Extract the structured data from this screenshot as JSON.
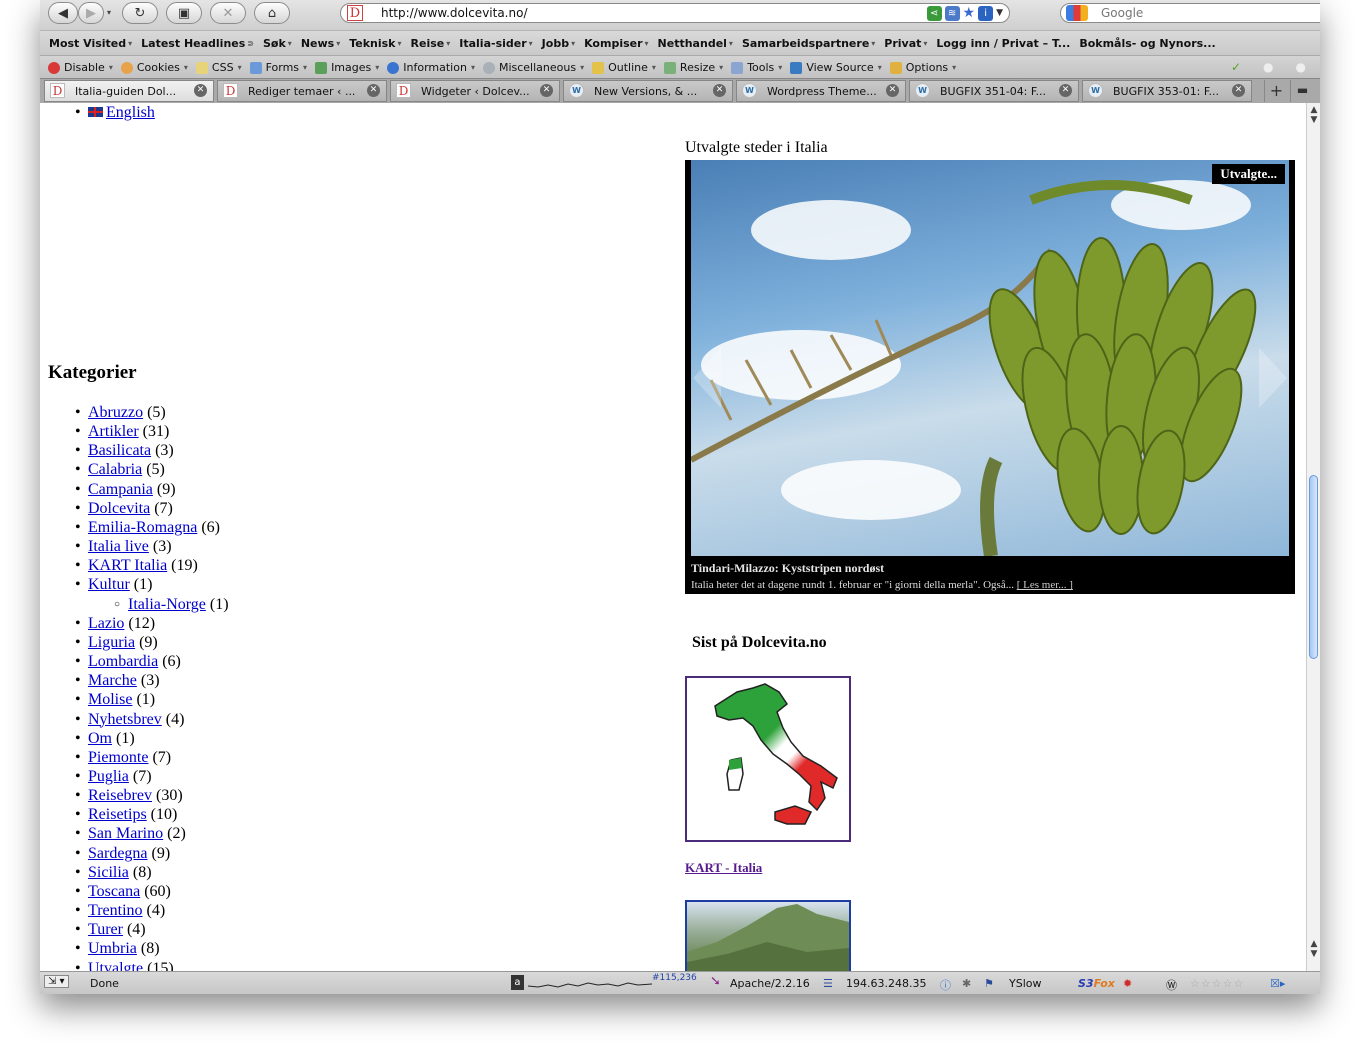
{
  "nav": {
    "url": "http://www.dolcevita.no/",
    "search_placeholder": "Google"
  },
  "bookmarks": [
    "Most Visited",
    "Latest Headlines",
    "Søk",
    "News",
    "Teknisk",
    "Reise",
    "Italia-sider",
    "Jobb",
    "Kompiser",
    "Netthandel",
    "Samarbeidspartnere",
    "Privat",
    "Logg inn / Privat – T...",
    "Bokmåls- og Nynors..."
  ],
  "devbar": [
    "Disable",
    "Cookies",
    "CSS",
    "Forms",
    "Images",
    "Information",
    "Miscellaneous",
    "Outline",
    "Resize",
    "Tools",
    "View Source",
    "Options"
  ],
  "tabs": [
    {
      "label": "Italia-guiden Dol...",
      "fav": "D",
      "active": true
    },
    {
      "label": "Rediger temaer ‹ ...",
      "fav": "D",
      "active": false
    },
    {
      "label": "Widgeter ‹ Dolcev...",
      "fav": "D",
      "active": false
    },
    {
      "label": "New Versions, & ...",
      "fav": "W",
      "active": false
    },
    {
      "label": "Wordpress Theme...",
      "fav": "W",
      "active": false
    },
    {
      "label": "BUGFIX 351-04: F...",
      "fav": "W",
      "active": false
    },
    {
      "label": "BUGFIX 353-01: F...",
      "fav": "W",
      "active": false
    }
  ],
  "page": {
    "lang_link": "English",
    "categories_title": "Kategorier",
    "categories": [
      {
        "name": "Abruzzo",
        "count": "(5)"
      },
      {
        "name": "Artikler",
        "count": "(31)"
      },
      {
        "name": "Basilicata",
        "count": "(3)"
      },
      {
        "name": "Calabria",
        "count": "(5)"
      },
      {
        "name": "Campania",
        "count": "(9)"
      },
      {
        "name": "Dolcevita",
        "count": "(7)"
      },
      {
        "name": "Emilia-Romagna",
        "count": "(6)"
      },
      {
        "name": "Italia live",
        "count": "(3)"
      },
      {
        "name": "KART Italia",
        "count": "(19)"
      },
      {
        "name": "Kultur",
        "count": "(1)"
      },
      {
        "name": "Italia-Norge",
        "count": "(1)",
        "sub": true
      },
      {
        "name": "Lazio",
        "count": "(12)"
      },
      {
        "name": "Liguria",
        "count": "(9)"
      },
      {
        "name": "Lombardia",
        "count": "(6)"
      },
      {
        "name": "Marche",
        "count": "(3)"
      },
      {
        "name": "Molise",
        "count": "(1)"
      },
      {
        "name": "Nyhetsbrev",
        "count": "(4)"
      },
      {
        "name": "Om",
        "count": "(1)"
      },
      {
        "name": "Piemonte",
        "count": "(7)"
      },
      {
        "name": "Puglia",
        "count": "(7)"
      },
      {
        "name": "Reisebrev",
        "count": "(30)"
      },
      {
        "name": "Reisetips",
        "count": "(10)"
      },
      {
        "name": "San Marino",
        "count": "(2)"
      },
      {
        "name": "Sardegna",
        "count": "(9)"
      },
      {
        "name": "Sicilia",
        "count": "(8)"
      },
      {
        "name": "Toscana",
        "count": "(60)"
      },
      {
        "name": "Trentino",
        "count": "(4)"
      },
      {
        "name": "Turer",
        "count": "(4)"
      },
      {
        "name": "Umbria",
        "count": "(8)"
      },
      {
        "name": "Utvalgte",
        "count": "(15)"
      }
    ],
    "slider_title": "Utvalgte steder i Italia",
    "slider_badge": "Utvalgte...",
    "slide_title": "Tindari-Milazzo: Kyststripen nordøst",
    "slide_excerpt": "Italia heter det at dagene rundt 1. februar er \"i giorni della merla\". Også...",
    "slide_more": "[ Les mer... ]",
    "recent_title": "Sist på Dolcevita.no",
    "map_link": "KART - Italia"
  },
  "status": {
    "text": "Done",
    "counter": "#115,236",
    "server": "Apache/2.2.16",
    "ip": "194.63.248.35",
    "yslow": "YSlow"
  },
  "colors": {
    "link": "#0000cc",
    "visited": "#551a8b",
    "scroll_thumb": "#a4c8f4"
  }
}
